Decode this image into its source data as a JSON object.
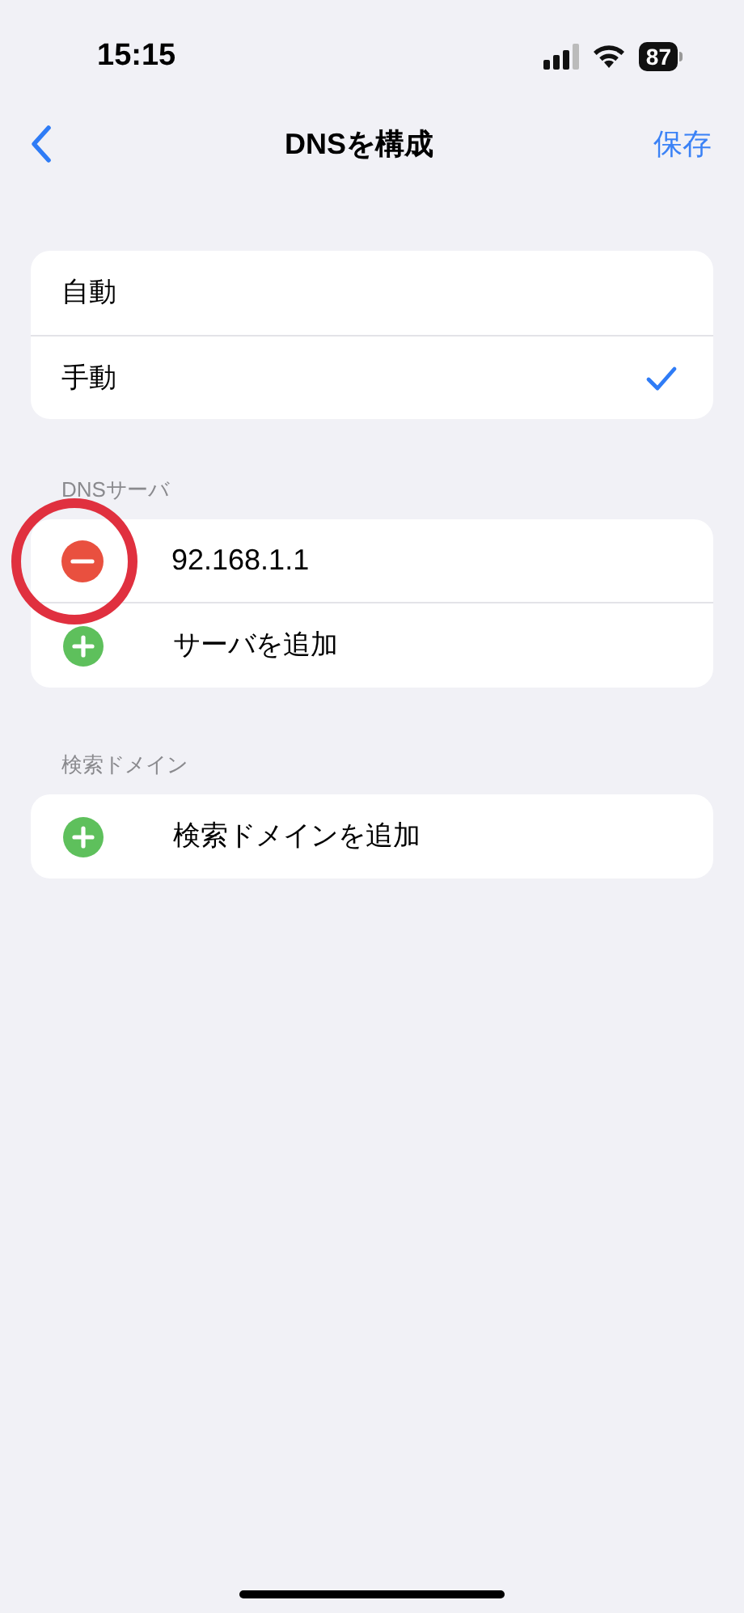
{
  "status_bar": {
    "time": "15:15",
    "battery": "87"
  },
  "nav": {
    "title": "DNSを構成",
    "action": "保存"
  },
  "modes": [
    {
      "label": "自動",
      "selected": false
    },
    {
      "label": "手動",
      "selected": true
    }
  ],
  "dns_section": {
    "header": "DNSサーバ",
    "servers": [
      {
        "address": "92.168.1.1",
        "highlighted": true
      }
    ],
    "add_label": "サーバを追加"
  },
  "search_section": {
    "header": "検索ドメイン",
    "add_label": "検索ドメインを追加"
  }
}
